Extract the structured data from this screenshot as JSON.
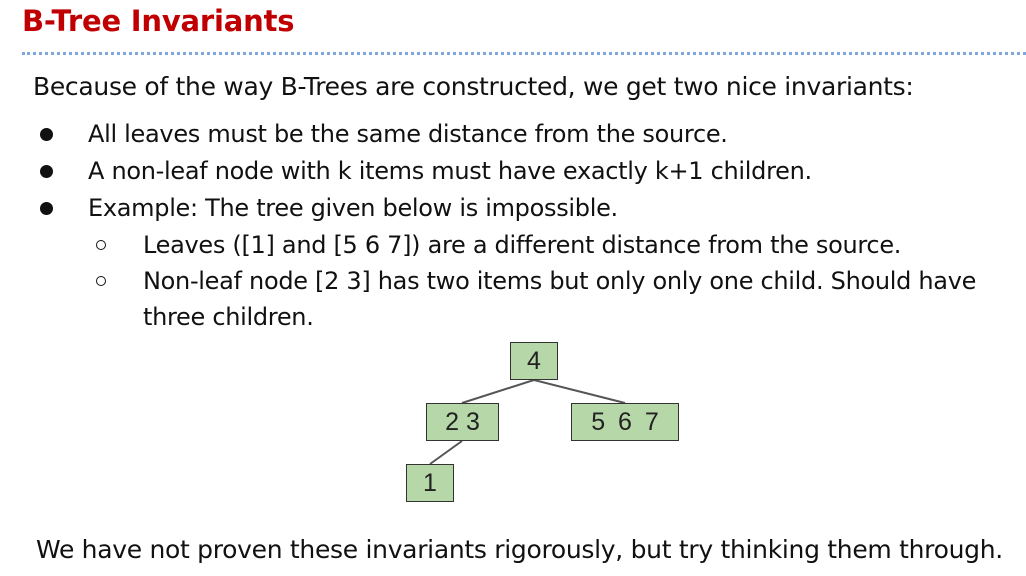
{
  "title": "B-Tree Invariants",
  "intro": "Because of the way B-Trees are constructed, we get two nice invariants:",
  "bullets": [
    "All leaves must be the same distance from the source.",
    "A non-leaf node with k items must have exactly k+1 children.",
    "Example: The tree given below is impossible."
  ],
  "sub_bullets": [
    "Leaves ([1] and [5 6 7]) are a different distance from the source.",
    "Non-leaf node [2 3] has two items but only only one child. Should have",
    "three children."
  ],
  "tree": {
    "root": "4",
    "left": "2 3",
    "right": "5 6 7",
    "leaf": "1"
  },
  "colors": {
    "title": "#c00000",
    "node_fill": "#b6d7a8",
    "edge": "#555555",
    "rule": "#7ea6e0"
  },
  "footer": "We have not proven these invariants rigorously, but try thinking them through."
}
